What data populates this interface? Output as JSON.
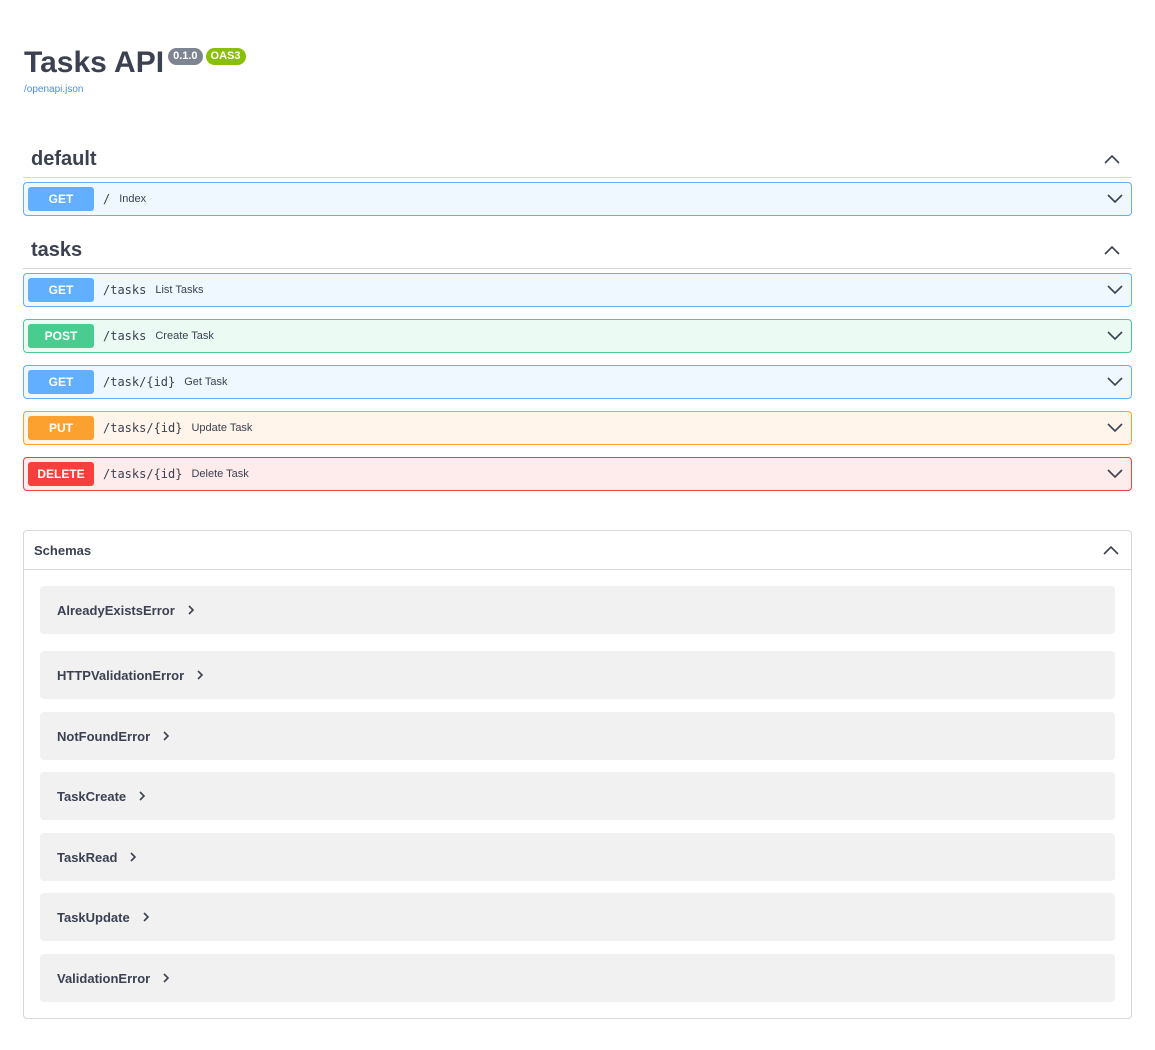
{
  "info": {
    "title": "Tasks API",
    "version": "0.1.0",
    "oas": "OAS3",
    "spec_link": "/openapi.json"
  },
  "tags": [
    {
      "name": "default",
      "operations": [
        {
          "method": "GET",
          "path": "/",
          "summary": "Index"
        }
      ]
    },
    {
      "name": "tasks",
      "operations": [
        {
          "method": "GET",
          "path": "/tasks",
          "summary": "List Tasks"
        },
        {
          "method": "POST",
          "path": "/tasks",
          "summary": "Create Task"
        },
        {
          "method": "GET",
          "path": "/task/{id}",
          "summary": "Get Task"
        },
        {
          "method": "PUT",
          "path": "/tasks/{id}",
          "summary": "Update Task"
        },
        {
          "method": "DELETE",
          "path": "/tasks/{id}",
          "summary": "Delete Task"
        }
      ]
    }
  ],
  "schemas": {
    "title": "Schemas",
    "models": [
      "AlreadyExistsError",
      "HTTPValidationError",
      "NotFoundError",
      "TaskCreate",
      "TaskRead",
      "TaskUpdate",
      "ValidationError"
    ]
  },
  "icons": {
    "collapse": "chevron-up-icon",
    "expand": "chevron-down-icon",
    "model_expand": "chevron-right-icon"
  },
  "colors": {
    "get": "#61affe",
    "post": "#49cc90",
    "put": "#fca130",
    "delete": "#f93e3e",
    "version_badge": "#7d8492",
    "oas_badge": "#89bf04"
  }
}
